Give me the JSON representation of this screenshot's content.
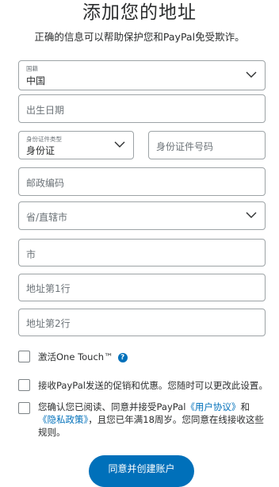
{
  "header": {
    "title": "添加您的地址",
    "subtitle": "正确的信息可以帮助保护您和PayPal免受欺诈。"
  },
  "form": {
    "country": {
      "label": "国籍",
      "value": "中国"
    },
    "birthdate": {
      "placeholder": "出生日期"
    },
    "id_type": {
      "label": "身份证件类型",
      "value": "身份证"
    },
    "id_number": {
      "placeholder": "身份证件号码"
    },
    "postal_code": {
      "placeholder": "邮政编码"
    },
    "province": {
      "placeholder": "省/直辖市"
    },
    "city": {
      "placeholder": "市"
    },
    "address1": {
      "placeholder": "地址第1行"
    },
    "address2": {
      "placeholder": "地址第2行"
    }
  },
  "checkboxes": {
    "one_touch": {
      "label": "激活One Touch™",
      "help_icon": "?"
    },
    "promotions": {
      "label": "接收PayPal发送的促销和优惠。您随时可以更改此设置。"
    },
    "terms": {
      "text1": "您确认您已阅读、同意并接受PayPal",
      "link1": "《用户协议》",
      "text2": "和",
      "link2": "《隐私政策》",
      "text3": "，且您已年满18周岁。您同意在线接收这些规则。"
    }
  },
  "submit": {
    "label": "同意并创建账户"
  },
  "colors": {
    "accent": "#0070ba",
    "border": "#9da3a6",
    "text": "#2c2e2f",
    "placeholder": "#6c7378"
  }
}
